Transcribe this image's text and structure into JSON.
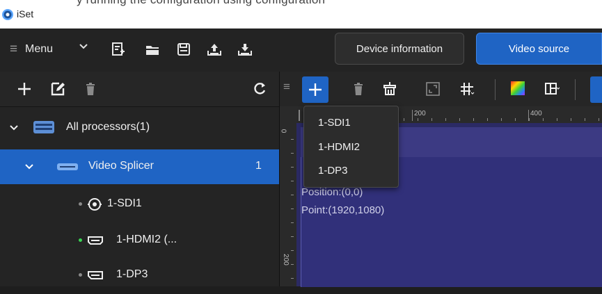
{
  "top_strip": {
    "cropped_text": "y running the configuration using configuration"
  },
  "app": {
    "title": "iSet"
  },
  "menu": {
    "label": "Menu"
  },
  "toolbar": {
    "icons": [
      "new-file-icon",
      "open-folder-icon",
      "save-icon",
      "upload-icon",
      "download-icon"
    ]
  },
  "tabs": {
    "device_info": "Device information",
    "video_source": "Video source"
  },
  "left_toolbar": {
    "icons": [
      "add-icon",
      "edit-icon",
      "delete-icon",
      "refresh-icon"
    ]
  },
  "tree": {
    "root": {
      "label": "All processors(1)"
    },
    "splicer": {
      "label": "Video Splicer",
      "count": "1"
    },
    "inputs": [
      {
        "label": "1-SDI1",
        "status": "inactive",
        "icon": "sdi-port-icon"
      },
      {
        "label": "1-HDMI2 (...",
        "status": "active",
        "icon": "hdmi-port-icon"
      },
      {
        "label": "1-DP3",
        "status": "inactive",
        "icon": "dp-port-icon"
      }
    ]
  },
  "right_toolbar": {
    "icons": [
      "add-icon",
      "delete-icon",
      "clear-icon",
      "fullscreen-icon",
      "grid-icon",
      "color-icon",
      "layout-icon"
    ]
  },
  "ruler": {
    "top_labels": [
      "200",
      "400"
    ],
    "left_labels": [
      "0",
      "200"
    ]
  },
  "canvas": {
    "position_text": "Position:(0,0)",
    "point_text": "Point:(1920,1080)"
  },
  "dropdown": {
    "items": [
      "1-SDI1",
      "1-HDMI2",
      "1-DP3"
    ]
  },
  "colors": {
    "accent": "#1f64c4",
    "active_dot": "#39d353",
    "inactive_dot": "#8a8a8a",
    "canvas": "#31307a"
  }
}
